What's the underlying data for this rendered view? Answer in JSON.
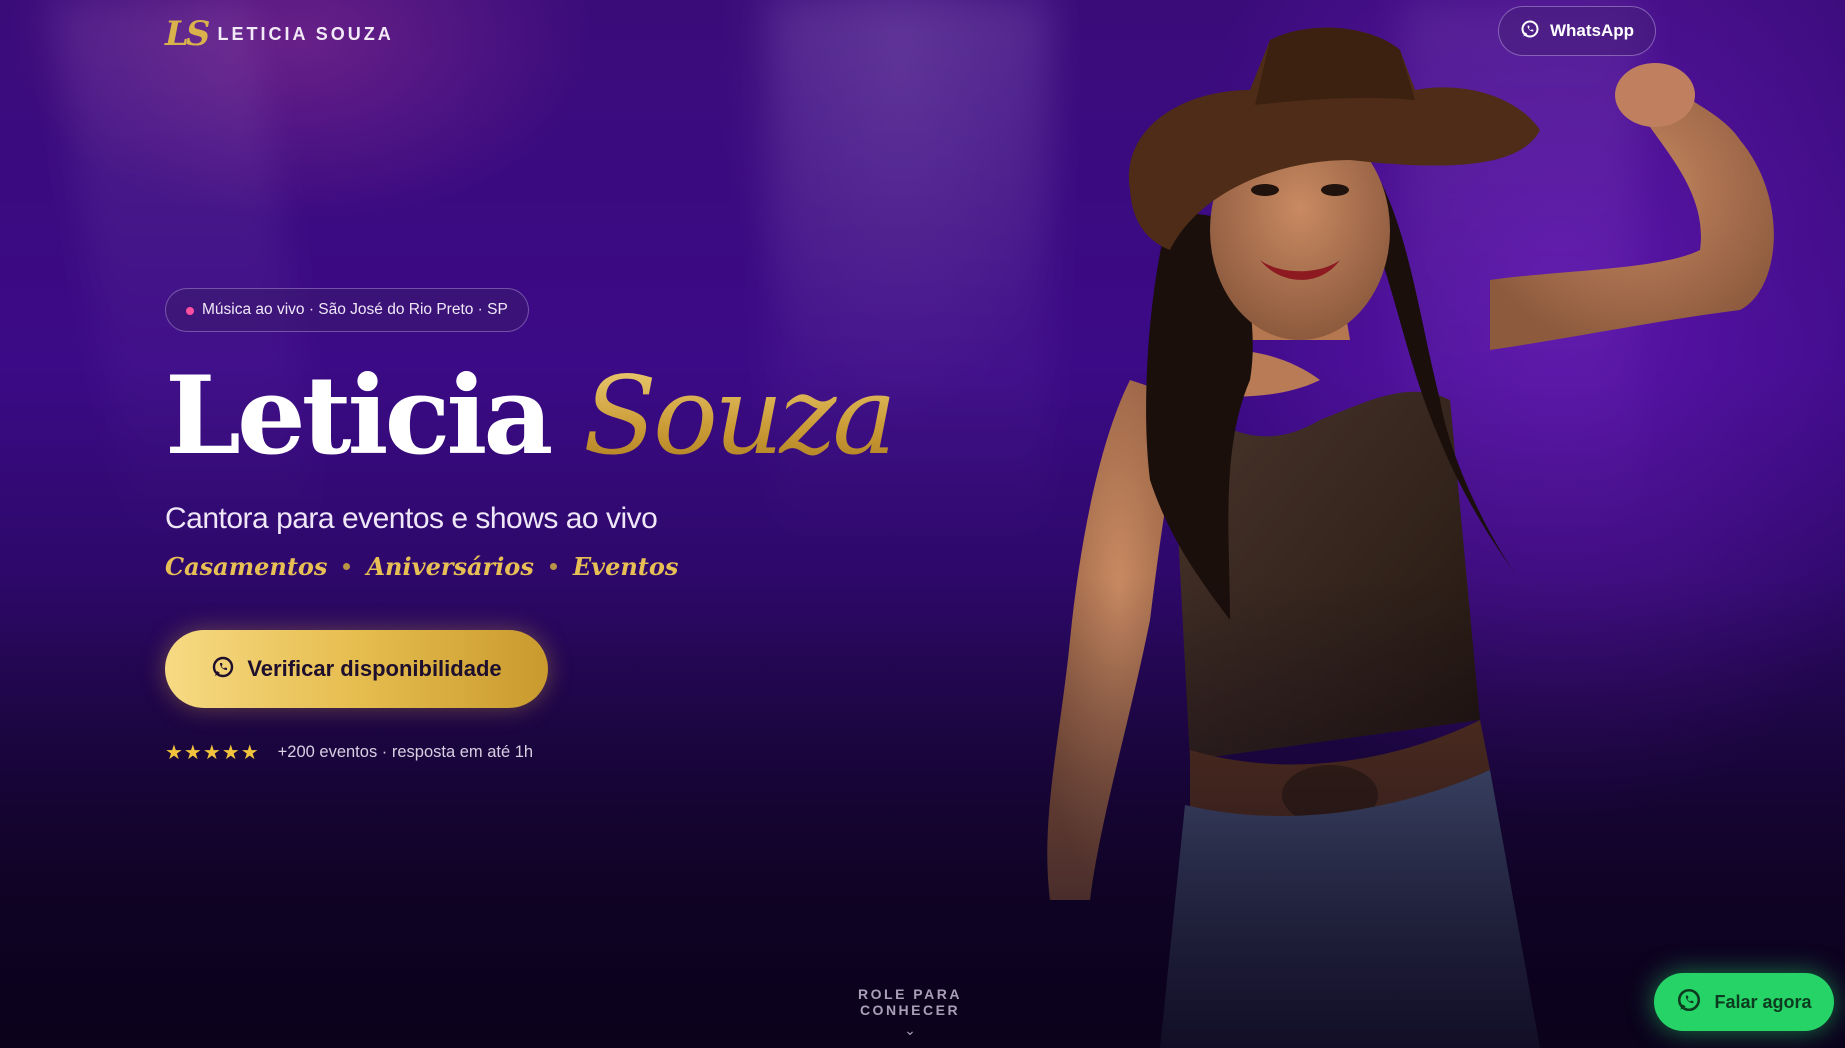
{
  "brand": {
    "monogram": "LS",
    "name": "LETICIA SOUZA"
  },
  "header": {
    "whatsapp_label": "WhatsApp"
  },
  "hero": {
    "badge": "Música ao vivo · São José do Rio Preto · SP",
    "title_first": "Leticia",
    "title_last": "Souza",
    "subtitle": "Cantora para eventos e shows ao vivo",
    "tags": [
      "Casamentos",
      "Aniversários",
      "Eventos"
    ],
    "cta_label": "Verificar disponibilidade",
    "stars": "★★★★★",
    "rating_text": "+200 eventos · resposta em até 1h"
  },
  "scroll_hint": {
    "label": "ROLE PARA CONHECER",
    "chevron": "⌄"
  },
  "floating": {
    "label": "Falar agora"
  },
  "icons": {
    "whatsapp": "whatsapp-icon",
    "chevron": "chevron-down-icon"
  },
  "colors": {
    "background": "#3b0a86",
    "gold": "#e6bd4f",
    "whatsapp_green": "#25d366",
    "badge_dot": "#ff4fa0"
  }
}
